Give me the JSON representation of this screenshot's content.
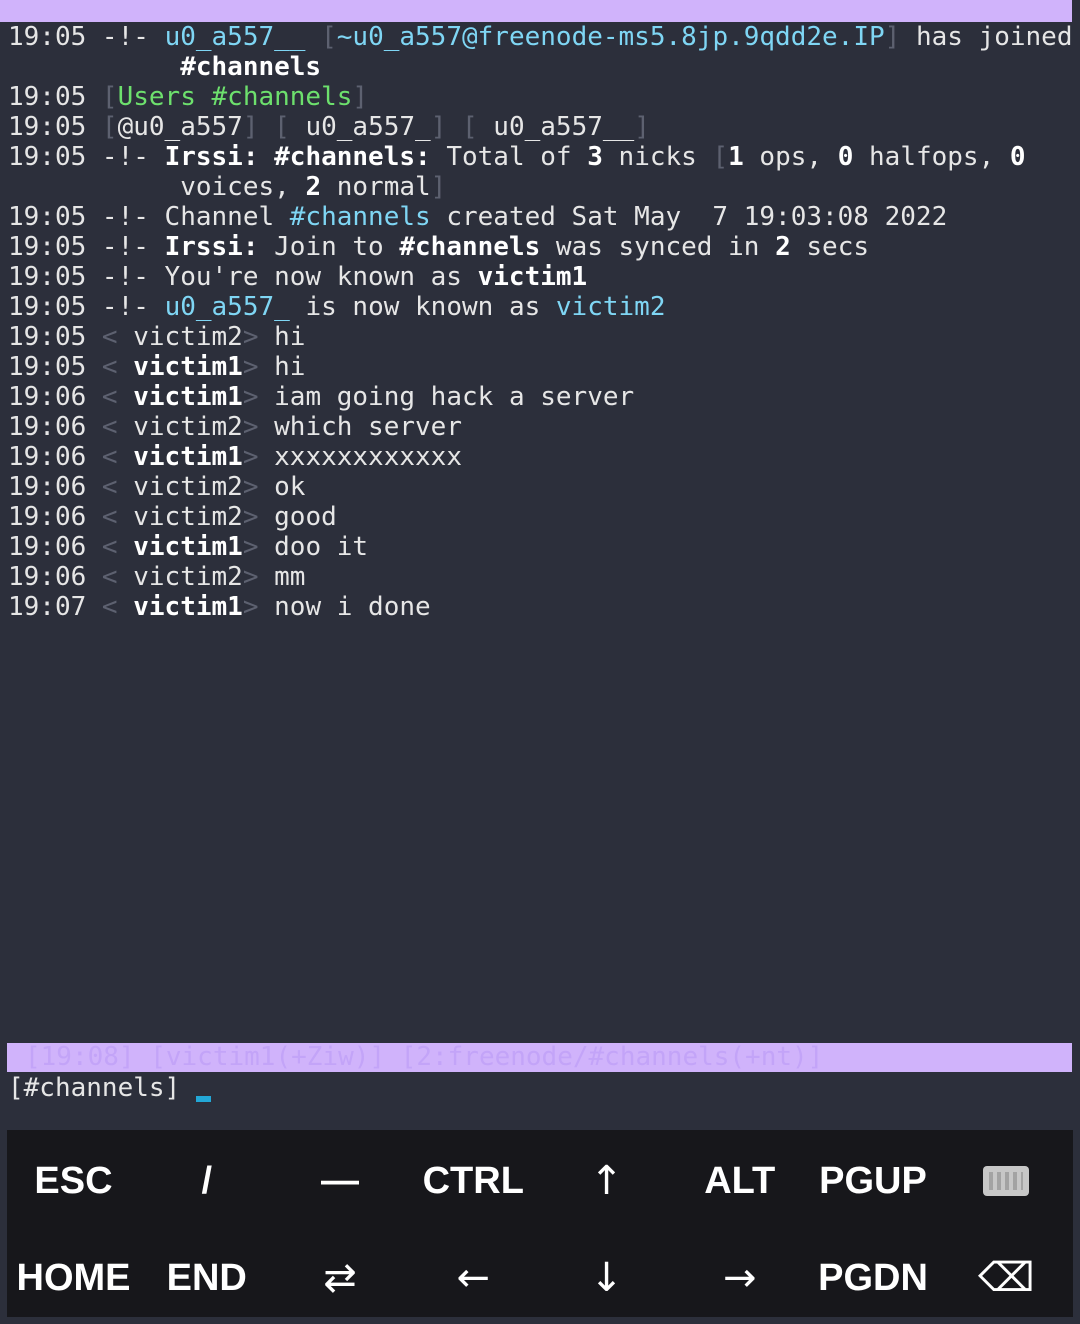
{
  "log": {
    "lines": [
      {
        "t": "19:05",
        "segs": [
          {
            "x": " -!- ",
            "c": ""
          },
          {
            "x": "u0_a557__",
            "c": "cyan"
          },
          {
            "x": " [",
            "c": "dim"
          },
          {
            "x": "~u0_a557@freenode-ms5.8jp.9qdd2e.IP",
            "c": "cyan"
          },
          {
            "x": "]",
            "c": "dim"
          },
          {
            "x": " has joined",
            "c": ""
          }
        ]
      },
      {
        "t": "",
        "segs": [
          {
            "x": "      ",
            "c": ""
          },
          {
            "x": "#channels",
            "c": "b"
          }
        ]
      },
      {
        "t": "19:05",
        "segs": [
          {
            "x": " [",
            "c": "dim"
          },
          {
            "x": "Users #channels",
            "c": "green"
          },
          {
            "x": "]",
            "c": "dim"
          }
        ]
      },
      {
        "t": "19:05",
        "segs": [
          {
            "x": " [",
            "c": "dim"
          },
          {
            "x": "@u0_a557",
            "c": ""
          },
          {
            "x": "] [",
            "c": "dim"
          },
          {
            "x": " u0_a557_",
            "c": ""
          },
          {
            "x": "] [",
            "c": "dim"
          },
          {
            "x": " u0_a557__",
            "c": ""
          },
          {
            "x": "]",
            "c": "dim"
          }
        ]
      },
      {
        "t": "19:05",
        "segs": [
          {
            "x": " -!- ",
            "c": ""
          },
          {
            "x": "Irssi:",
            "c": "b"
          },
          {
            "x": " ",
            "c": ""
          },
          {
            "x": "#channels:",
            "c": "b"
          },
          {
            "x": " Total of ",
            "c": ""
          },
          {
            "x": "3",
            "c": "b"
          },
          {
            "x": " nicks ",
            "c": ""
          },
          {
            "x": "[",
            "c": "dim"
          },
          {
            "x": "1",
            "c": "b"
          },
          {
            "x": " ops, ",
            "c": ""
          },
          {
            "x": "0",
            "c": "b"
          },
          {
            "x": " halfops, ",
            "c": ""
          },
          {
            "x": "0",
            "c": "b"
          }
        ]
      },
      {
        "t": "",
        "segs": [
          {
            "x": "      voices, ",
            "c": ""
          },
          {
            "x": "2",
            "c": "b"
          },
          {
            "x": " normal",
            "c": ""
          },
          {
            "x": "]",
            "c": "dim"
          }
        ]
      },
      {
        "t": "19:05",
        "segs": [
          {
            "x": " -!- Channel ",
            "c": ""
          },
          {
            "x": "#channels",
            "c": "cyan"
          },
          {
            "x": " created Sat May  7 19:03:08 2022",
            "c": ""
          }
        ]
      },
      {
        "t": "19:05",
        "segs": [
          {
            "x": " -!- ",
            "c": ""
          },
          {
            "x": "Irssi:",
            "c": "b"
          },
          {
            "x": " Join to ",
            "c": ""
          },
          {
            "x": "#channels",
            "c": "b"
          },
          {
            "x": " was synced in ",
            "c": ""
          },
          {
            "x": "2",
            "c": "b"
          },
          {
            "x": " secs",
            "c": ""
          }
        ]
      },
      {
        "t": "19:05",
        "segs": [
          {
            "x": " -!- You're now known as ",
            "c": ""
          },
          {
            "x": "victim1",
            "c": "b"
          }
        ]
      },
      {
        "t": "19:05",
        "segs": [
          {
            "x": " -!- ",
            "c": ""
          },
          {
            "x": "u0_a557_",
            "c": "cyan"
          },
          {
            "x": " is now known as ",
            "c": ""
          },
          {
            "x": "victim2",
            "c": "cyan"
          }
        ]
      },
      {
        "t": "19:05",
        "segs": [
          {
            "x": " <",
            "c": "dim"
          },
          {
            "x": " victim2",
            "c": ""
          },
          {
            "x": ">",
            "c": "dim"
          },
          {
            "x": " hi",
            "c": ""
          }
        ]
      },
      {
        "t": "19:05",
        "segs": [
          {
            "x": " <",
            "c": "dim"
          },
          {
            "x": " victim1",
            "c": "b"
          },
          {
            "x": ">",
            "c": "dim"
          },
          {
            "x": " hi",
            "c": ""
          }
        ]
      },
      {
        "t": "19:06",
        "segs": [
          {
            "x": " <",
            "c": "dim"
          },
          {
            "x": " victim1",
            "c": "b"
          },
          {
            "x": ">",
            "c": "dim"
          },
          {
            "x": " iam going hack a server",
            "c": ""
          }
        ]
      },
      {
        "t": "19:06",
        "segs": [
          {
            "x": " <",
            "c": "dim"
          },
          {
            "x": " victim2",
            "c": ""
          },
          {
            "x": ">",
            "c": "dim"
          },
          {
            "x": " which server",
            "c": ""
          }
        ]
      },
      {
        "t": "19:06",
        "segs": [
          {
            "x": " <",
            "c": "dim"
          },
          {
            "x": " victim1",
            "c": "b"
          },
          {
            "x": ">",
            "c": "dim"
          },
          {
            "x": " xxxxxxxxxxxx",
            "c": ""
          }
        ]
      },
      {
        "t": "19:06",
        "segs": [
          {
            "x": " <",
            "c": "dim"
          },
          {
            "x": " victim2",
            "c": ""
          },
          {
            "x": ">",
            "c": "dim"
          },
          {
            "x": " ok",
            "c": ""
          }
        ]
      },
      {
        "t": "19:06",
        "segs": [
          {
            "x": " <",
            "c": "dim"
          },
          {
            "x": " victim2",
            "c": ""
          },
          {
            "x": ">",
            "c": "dim"
          },
          {
            "x": " good",
            "c": ""
          }
        ]
      },
      {
        "t": "19:06",
        "segs": [
          {
            "x": " <",
            "c": "dim"
          },
          {
            "x": " victim1",
            "c": "b"
          },
          {
            "x": ">",
            "c": "dim"
          },
          {
            "x": " doo it",
            "c": ""
          }
        ]
      },
      {
        "t": "19:06",
        "segs": [
          {
            "x": " <",
            "c": "dim"
          },
          {
            "x": " victim2",
            "c": ""
          },
          {
            "x": ">",
            "c": "dim"
          },
          {
            "x": " mm",
            "c": ""
          }
        ]
      },
      {
        "t": "19:07",
        "segs": [
          {
            "x": " <",
            "c": "dim"
          },
          {
            "x": " victim1",
            "c": "b"
          },
          {
            "x": ">",
            "c": "dim"
          },
          {
            "x": " now i done",
            "c": ""
          }
        ]
      }
    ]
  },
  "statusbar": {
    "text": "[19:08] [victim1(+Ziw)] [2:freenode/#channels(+nt)]"
  },
  "input": {
    "prompt": "[#channels]"
  },
  "colors": {
    "background": "#2c2f3b",
    "accent_bar": "#d0b3fb",
    "nick_cyan": "#7fd6f4",
    "users_green": "#6de06d",
    "cursor": "#23a7d6",
    "keys_bg": "#17171b"
  },
  "keys": {
    "row1": [
      {
        "label": "ESC",
        "name": "esc-key"
      },
      {
        "label": "/",
        "name": "slash-key"
      },
      {
        "label": "―",
        "name": "dash-key"
      },
      {
        "label": "CTRL",
        "name": "ctrl-key"
      },
      {
        "label": "↑",
        "name": "arrow-up-key",
        "icon": "arrow-up-icon"
      },
      {
        "label": "ALT",
        "name": "alt-key"
      },
      {
        "label": "PGUP",
        "name": "pgup-key"
      },
      {
        "label": "",
        "name": "keyboard-toggle-key",
        "icon": "keyboard-icon"
      }
    ],
    "row2": [
      {
        "label": "HOME",
        "name": "home-key"
      },
      {
        "label": "END",
        "name": "end-key"
      },
      {
        "label": "⇄",
        "name": "tab-key",
        "icon": "tab-arrows-icon"
      },
      {
        "label": "←",
        "name": "arrow-left-key",
        "icon": "arrow-left-icon"
      },
      {
        "label": "↓",
        "name": "arrow-down-key",
        "icon": "arrow-down-icon"
      },
      {
        "label": "→",
        "name": "arrow-right-key",
        "icon": "arrow-right-icon"
      },
      {
        "label": "PGDN",
        "name": "pgdn-key"
      },
      {
        "label": "⌫",
        "name": "backspace-key",
        "icon": "backspace-icon"
      }
    ]
  }
}
